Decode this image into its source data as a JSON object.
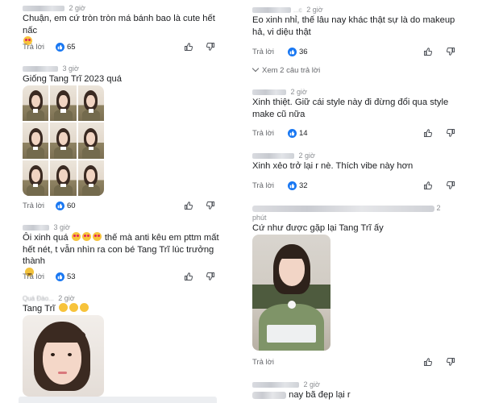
{
  "reply_label": "Trả lời",
  "left": [
    {
      "time": "2 giờ",
      "text": "Chuận, em cứ tròn tròn má bánh bao là cute hết nấc",
      "likes": "65"
    },
    {
      "time": "3 giờ",
      "text": "Giống Tang Trĩ 2023 quá",
      "likes": "60"
    },
    {
      "time": "3 giờ",
      "text": "Ôi xinh quá",
      "text2": "thế mà anti kêu em pttm mất",
      "text3": "hết nét, t vẫn nhìn ra con bé Tang Trĩ lúc trưởng",
      "text4": "thành",
      "likes": "53"
    },
    {
      "author": "Quá Đào...",
      "time": "2 giờ",
      "text": "Tang Trĩ"
    }
  ],
  "right": [
    {
      "author": "...c",
      "time": "2 giờ",
      "text": "Eo xinh nhỉ, thế lâu nay khác thật sự là do makeup",
      "text2": "hả, vi diệu thật",
      "likes": "36",
      "see_replies": "Xem 2 câu trả lời"
    },
    {
      "time": "2 giờ",
      "text": "Xinh thiệt. Giữ cái style này đi đừng đổi qua style",
      "text2": "make cũ nữa",
      "likes": "14"
    },
    {
      "time": "2 giờ",
      "text": "Xinh xẻo trở lại r nè. Thích vibe này hơn",
      "likes": "32"
    },
    {
      "time": "2",
      "time_unit": "phút",
      "text": "Cứ như được gặp lại Tang Trĩ ấy"
    },
    {
      "time": "2 giờ",
      "text": "nay bã đẹp lại r"
    }
  ],
  "colors": {
    "like_blue": "#1877f2",
    "meta_grey": "#8a8d91",
    "text": "#1c1e21"
  }
}
